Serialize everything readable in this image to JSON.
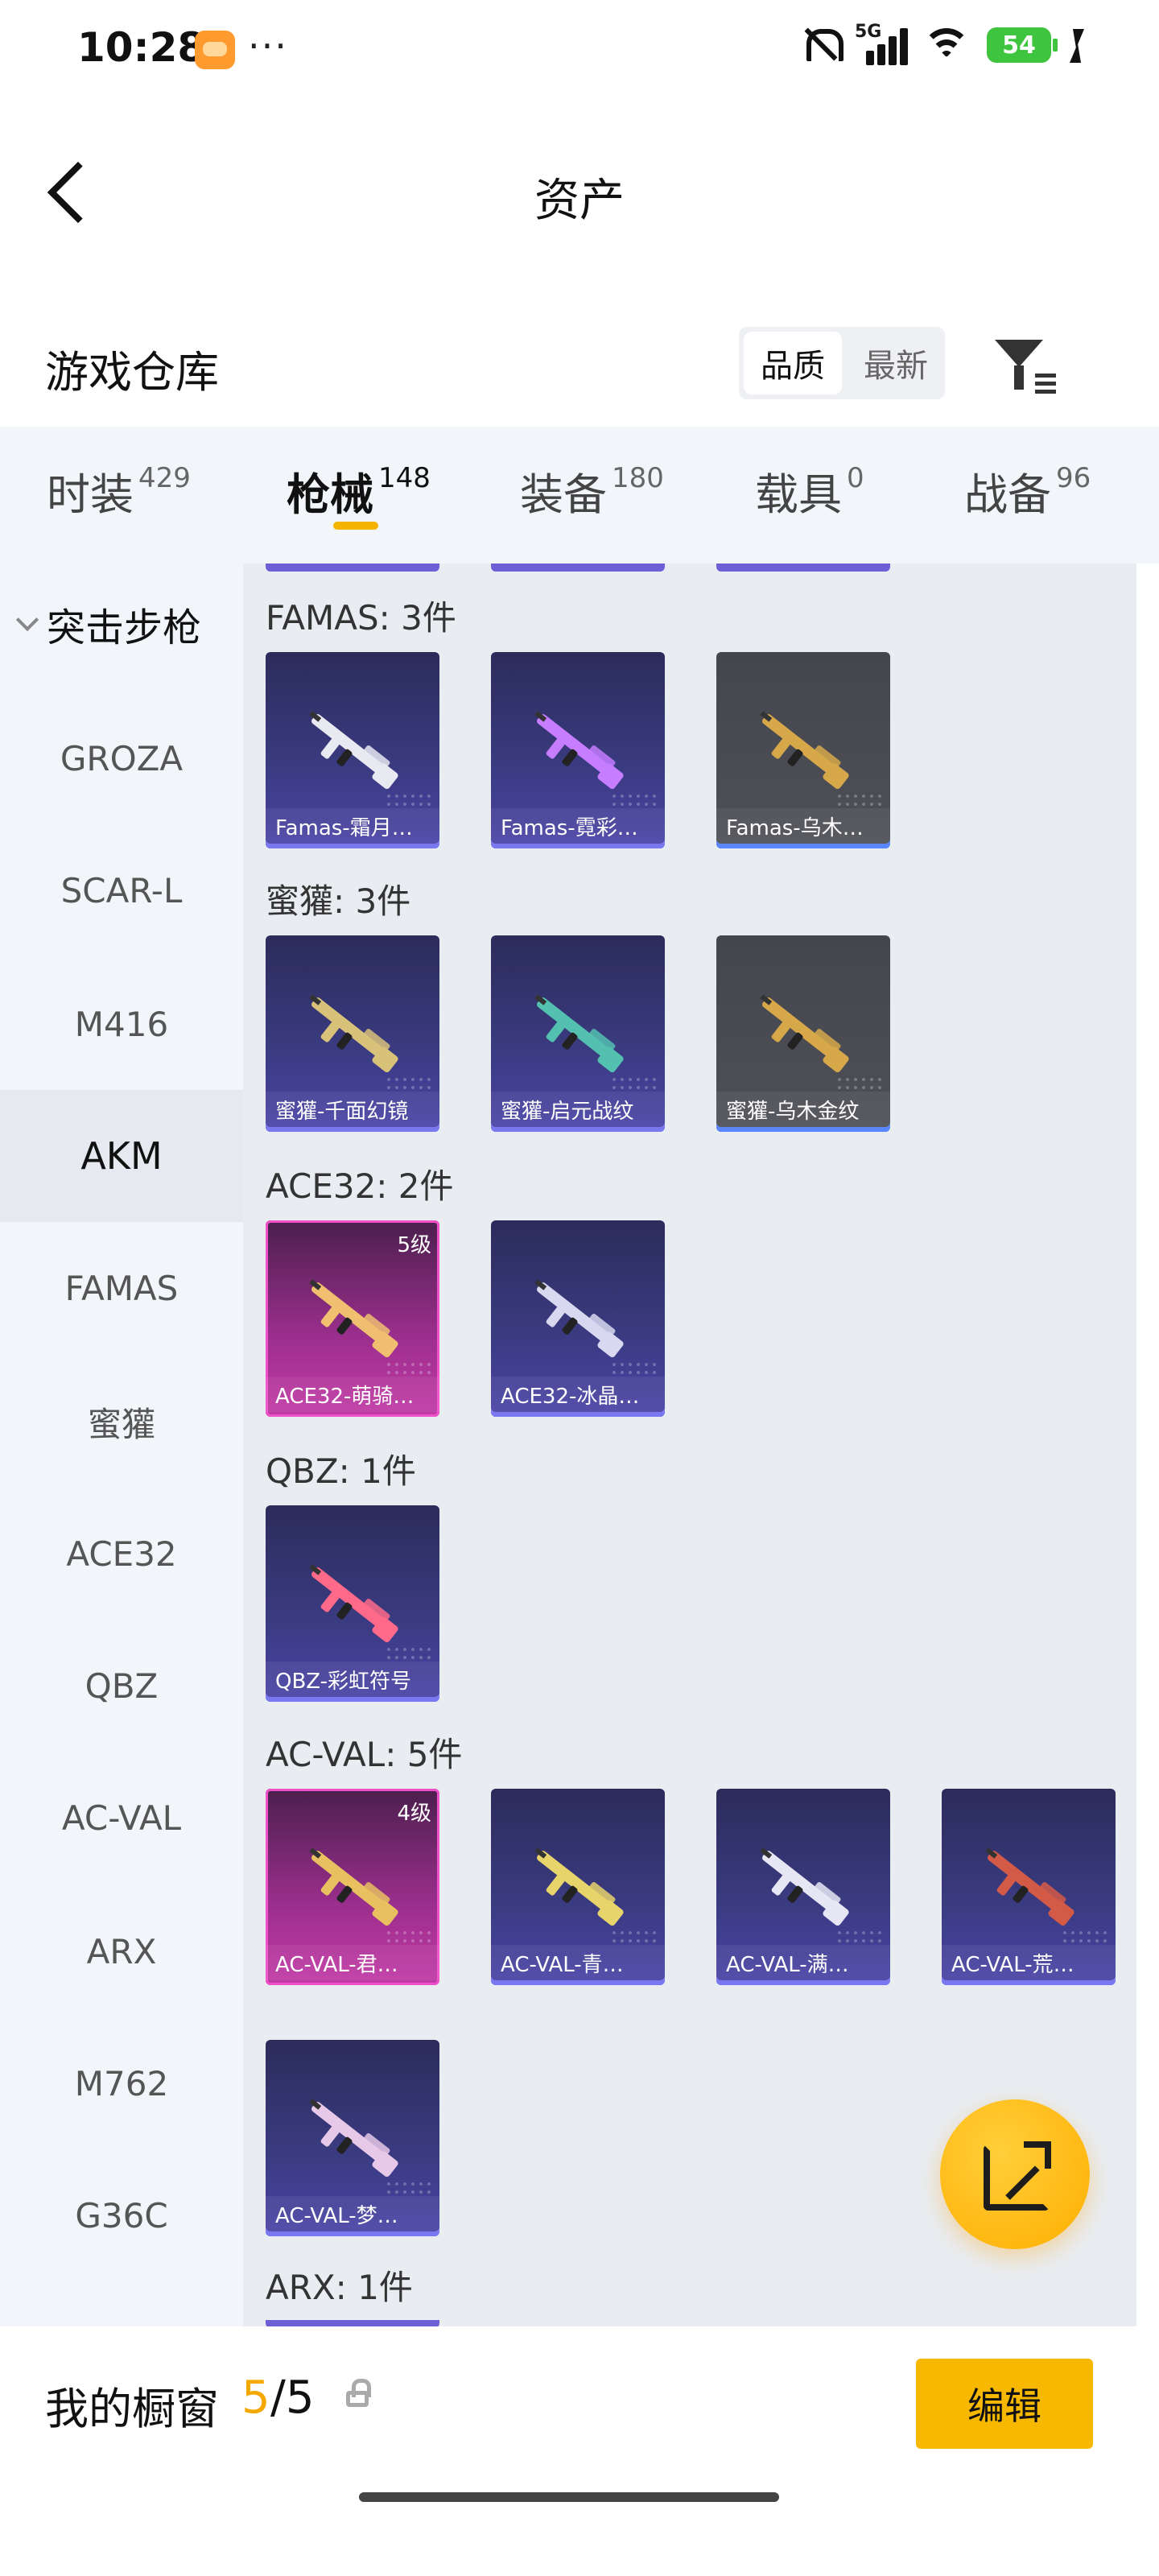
{
  "status": {
    "time": "10:28",
    "dots": "···",
    "battery": "54",
    "net": "5G"
  },
  "header": {
    "title": "资产"
  },
  "warehouse": {
    "title": "游戏仓库",
    "sort": [
      "品质",
      "最新"
    ]
  },
  "categories": [
    {
      "label": "时装",
      "count": "429"
    },
    {
      "label": "枪械",
      "count": "148"
    },
    {
      "label": "装备",
      "count": "180"
    },
    {
      "label": "载具",
      "count": "0"
    },
    {
      "label": "战备",
      "count": "96"
    }
  ],
  "sidebar": {
    "header": "突击步枪",
    "items": [
      "GROZA",
      "SCAR-L",
      "M416",
      "AKM",
      "FAMAS",
      "蜜獾",
      "ACE32",
      "QBZ",
      "AC-VAL",
      "ARX",
      "M762",
      "G36C"
    ],
    "active": "AKM"
  },
  "groups": [
    {
      "title": "FAMAS: 3件",
      "items": [
        {
          "name": "Famas-霜月…",
          "style": "purple"
        },
        {
          "name": "Famas-霓彩…",
          "style": "purple"
        },
        {
          "name": "Famas-乌木…",
          "style": "gray"
        }
      ]
    },
    {
      "title": "蜜獾: 3件",
      "items": [
        {
          "name": "蜜獾-千面幻镜",
          "style": "purple"
        },
        {
          "name": "蜜獾-启元战纹",
          "style": "purple"
        },
        {
          "name": "蜜獾-乌木金纹",
          "style": "gray"
        }
      ]
    },
    {
      "title": "ACE32: 2件",
      "items": [
        {
          "name": "ACE32-萌骑…",
          "style": "pink",
          "level": "5级"
        },
        {
          "name": "ACE32-冰晶…",
          "style": "purple"
        }
      ]
    },
    {
      "title": "QBZ: 1件",
      "items": [
        {
          "name": "QBZ-彩虹符号",
          "style": "purple"
        }
      ]
    },
    {
      "title": "AC-VAL: 5件",
      "items": [
        {
          "name": "AC-VAL-君…",
          "style": "pink",
          "level": "4级"
        },
        {
          "name": "AC-VAL-青…",
          "style": "purple"
        },
        {
          "name": "AC-VAL-满…",
          "style": "purple"
        },
        {
          "name": "AC-VAL-荒…",
          "style": "purple"
        },
        {
          "name": "AC-VAL-梦…",
          "style": "purple"
        }
      ]
    },
    {
      "title": "ARX: 1件",
      "items": []
    }
  ],
  "bottom": {
    "label": "我的橱窗",
    "current": "5",
    "total": "/5",
    "edit": "编辑"
  },
  "colors": {
    "accent": "#f5b400",
    "card_purple": "#3b3b82",
    "card_gray": "#4f5057",
    "card_pink": "#c23aa6"
  }
}
